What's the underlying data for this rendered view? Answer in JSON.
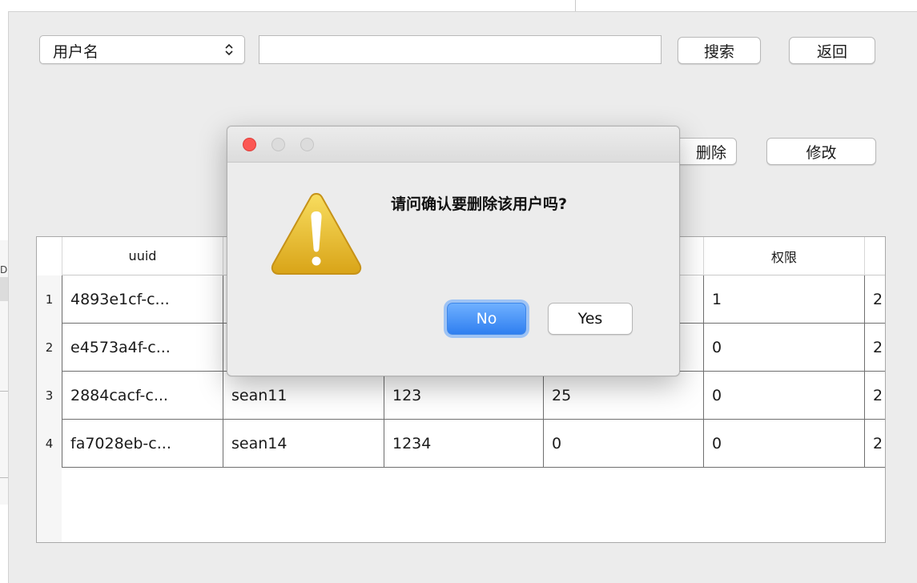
{
  "toolbar": {
    "field_select_value": "用户名",
    "search_value": "",
    "search_placeholder": "",
    "search_label": "搜索",
    "back_label": "返回",
    "delete_label_visible": "删除",
    "edit_label": "修改"
  },
  "bg_window": {
    "partial_text": "De"
  },
  "table": {
    "headers": [
      "uuid",
      "",
      "",
      "",
      "权限",
      ""
    ],
    "rows": [
      {
        "num": "1",
        "cells": [
          "4893e1cf-c...",
          "",
          "",
          "",
          "1",
          "2"
        ]
      },
      {
        "num": "2",
        "cells": [
          "e4573a4f-c...",
          "",
          "",
          "",
          "0",
          "2"
        ]
      },
      {
        "num": "3",
        "cells": [
          "2884cacf-c...",
          "sean11",
          "123",
          "25",
          "0",
          "2"
        ]
      },
      {
        "num": "4",
        "cells": [
          "fa7028eb-c...",
          "sean14",
          "1234",
          "0",
          "0",
          "2"
        ]
      }
    ]
  },
  "dialog": {
    "message": "请问确认要删除该用户吗?",
    "no_label": "No",
    "yes_label": "Yes",
    "icon": "warning-icon"
  },
  "colors": {
    "accent": "#2f7ff0",
    "close_button": "#fc5753",
    "warning": "#e8b72a"
  }
}
